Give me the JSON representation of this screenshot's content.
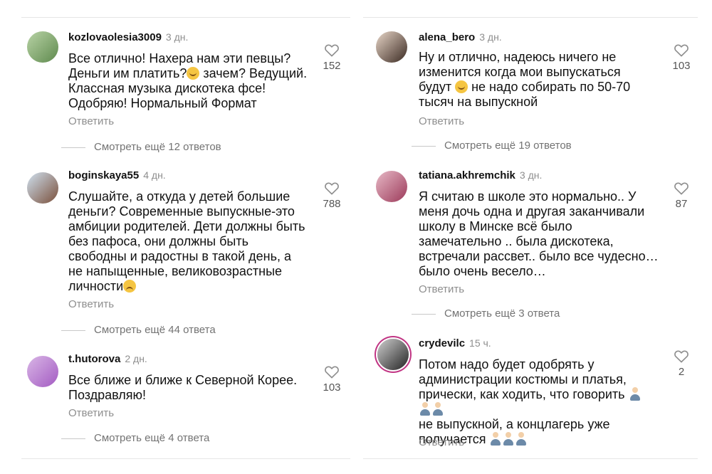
{
  "reply_label": "Ответить",
  "left": [
    {
      "username": "kozlovaolesia3009",
      "time": "3 дн.",
      "text": "Все отлично! Нахера нам эти певцы?\nДеньги им платить?",
      "text_tail": " зачем? Ведущий.\nКлассная музыка дискотека фсе!\nОдобряю! Нормальный Формат",
      "likes": "152",
      "view_replies": "Смотреть ещё 12 ответов",
      "avatar_colors": [
        "#b8d3a6",
        "#5f8a4e"
      ]
    },
    {
      "username": "boginskaya55",
      "time": "4 дн.",
      "text": "Слушайте, а откуда у детей большие\nденьги? Современные выпускные-это\nамбиции родителей. Дети должны быть\nбез пафоса, они должны быть\nсвободны и радостны в такой день, а\nне напыщенные, великовозрастные\nличности",
      "likes": "788",
      "view_replies": "Смотреть ещё 44 ответа",
      "avatar_colors": [
        "#cfe1f0",
        "#7a4f3a"
      ]
    },
    {
      "username": "t.hutorova",
      "time": "2 дн.",
      "text": "Все ближе и ближе к Северной Корее.\nПоздравляю!",
      "likes": "103",
      "view_replies": "Смотреть ещё 4 ответа",
      "avatar_colors": [
        "#d9b6e6",
        "#a35bc2"
      ]
    }
  ],
  "right": [
    {
      "username": "alena_bero",
      "time": "3 дн.",
      "text": "Ну и отлично, надеюсь ничего не\nизменится когда мои выпускаться\nбудут",
      "text_tail": " не надо собирать по 50-70\nтысяч на выпускной",
      "likes": "103",
      "view_replies": "Смотреть ещё 19 ответов",
      "avatar_colors": [
        "#e8d6c8",
        "#3b2a22"
      ]
    },
    {
      "username": "tatiana.akhremchik",
      "time": "3 дн.",
      "text": "Я считаю в школе это нормально.. У\nменя дочь одна и другая заканчивали\nшколу в Минске всё было\nзамечательно .. была дискотека,\nвстречали рассвет.. было все чудесно…\nбыло очень весело…",
      "likes": "87",
      "view_replies": "Смотреть ещё 3 ответа",
      "avatar_colors": [
        "#e7b9c6",
        "#9c3a5a"
      ]
    },
    {
      "username": "crydevilc",
      "time": "15 ч.",
      "text": "Потом надо будет одобрять у\nадминистрации костюмы и платья,\nпрически, как ходить, что говорить",
      "text_tail": "\n не выпускной, а концлагерь уже\nполучается",
      "likes": "2",
      "avatar_colors": [
        "#d0d0d0",
        "#222222"
      ]
    }
  ]
}
